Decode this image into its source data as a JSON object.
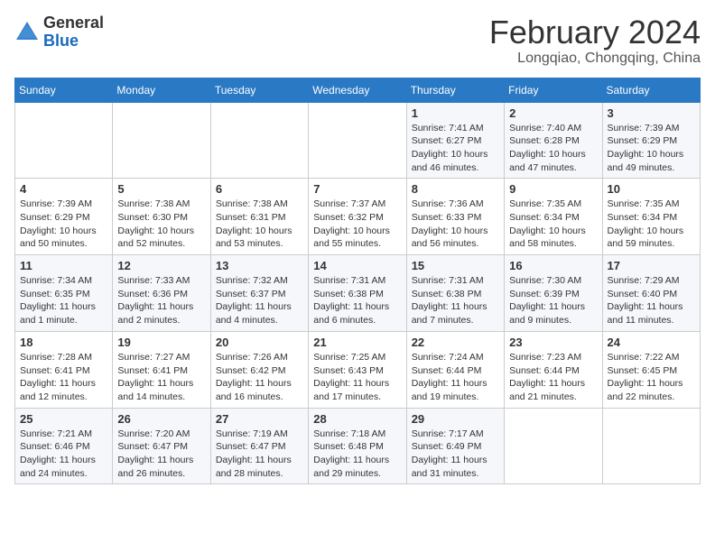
{
  "header": {
    "logo_general": "General",
    "logo_blue": "Blue",
    "month_title": "February 2024",
    "location": "Longqiao, Chongqing, China"
  },
  "days_of_week": [
    "Sunday",
    "Monday",
    "Tuesday",
    "Wednesday",
    "Thursday",
    "Friday",
    "Saturday"
  ],
  "weeks": [
    [
      {
        "day": "",
        "info": ""
      },
      {
        "day": "",
        "info": ""
      },
      {
        "day": "",
        "info": ""
      },
      {
        "day": "",
        "info": ""
      },
      {
        "day": "1",
        "info": "Sunrise: 7:41 AM\nSunset: 6:27 PM\nDaylight: 10 hours\nand 46 minutes."
      },
      {
        "day": "2",
        "info": "Sunrise: 7:40 AM\nSunset: 6:28 PM\nDaylight: 10 hours\nand 47 minutes."
      },
      {
        "day": "3",
        "info": "Sunrise: 7:39 AM\nSunset: 6:29 PM\nDaylight: 10 hours\nand 49 minutes."
      }
    ],
    [
      {
        "day": "4",
        "info": "Sunrise: 7:39 AM\nSunset: 6:29 PM\nDaylight: 10 hours\nand 50 minutes."
      },
      {
        "day": "5",
        "info": "Sunrise: 7:38 AM\nSunset: 6:30 PM\nDaylight: 10 hours\nand 52 minutes."
      },
      {
        "day": "6",
        "info": "Sunrise: 7:38 AM\nSunset: 6:31 PM\nDaylight: 10 hours\nand 53 minutes."
      },
      {
        "day": "7",
        "info": "Sunrise: 7:37 AM\nSunset: 6:32 PM\nDaylight: 10 hours\nand 55 minutes."
      },
      {
        "day": "8",
        "info": "Sunrise: 7:36 AM\nSunset: 6:33 PM\nDaylight: 10 hours\nand 56 minutes."
      },
      {
        "day": "9",
        "info": "Sunrise: 7:35 AM\nSunset: 6:34 PM\nDaylight: 10 hours\nand 58 minutes."
      },
      {
        "day": "10",
        "info": "Sunrise: 7:35 AM\nSunset: 6:34 PM\nDaylight: 10 hours\nand 59 minutes."
      }
    ],
    [
      {
        "day": "11",
        "info": "Sunrise: 7:34 AM\nSunset: 6:35 PM\nDaylight: 11 hours\nand 1 minute."
      },
      {
        "day": "12",
        "info": "Sunrise: 7:33 AM\nSunset: 6:36 PM\nDaylight: 11 hours\nand 2 minutes."
      },
      {
        "day": "13",
        "info": "Sunrise: 7:32 AM\nSunset: 6:37 PM\nDaylight: 11 hours\nand 4 minutes."
      },
      {
        "day": "14",
        "info": "Sunrise: 7:31 AM\nSunset: 6:38 PM\nDaylight: 11 hours\nand 6 minutes."
      },
      {
        "day": "15",
        "info": "Sunrise: 7:31 AM\nSunset: 6:38 PM\nDaylight: 11 hours\nand 7 minutes."
      },
      {
        "day": "16",
        "info": "Sunrise: 7:30 AM\nSunset: 6:39 PM\nDaylight: 11 hours\nand 9 minutes."
      },
      {
        "day": "17",
        "info": "Sunrise: 7:29 AM\nSunset: 6:40 PM\nDaylight: 11 hours\nand 11 minutes."
      }
    ],
    [
      {
        "day": "18",
        "info": "Sunrise: 7:28 AM\nSunset: 6:41 PM\nDaylight: 11 hours\nand 12 minutes."
      },
      {
        "day": "19",
        "info": "Sunrise: 7:27 AM\nSunset: 6:41 PM\nDaylight: 11 hours\nand 14 minutes."
      },
      {
        "day": "20",
        "info": "Sunrise: 7:26 AM\nSunset: 6:42 PM\nDaylight: 11 hours\nand 16 minutes."
      },
      {
        "day": "21",
        "info": "Sunrise: 7:25 AM\nSunset: 6:43 PM\nDaylight: 11 hours\nand 17 minutes."
      },
      {
        "day": "22",
        "info": "Sunrise: 7:24 AM\nSunset: 6:44 PM\nDaylight: 11 hours\nand 19 minutes."
      },
      {
        "day": "23",
        "info": "Sunrise: 7:23 AM\nSunset: 6:44 PM\nDaylight: 11 hours\nand 21 minutes."
      },
      {
        "day": "24",
        "info": "Sunrise: 7:22 AM\nSunset: 6:45 PM\nDaylight: 11 hours\nand 22 minutes."
      }
    ],
    [
      {
        "day": "25",
        "info": "Sunrise: 7:21 AM\nSunset: 6:46 PM\nDaylight: 11 hours\nand 24 minutes."
      },
      {
        "day": "26",
        "info": "Sunrise: 7:20 AM\nSunset: 6:47 PM\nDaylight: 11 hours\nand 26 minutes."
      },
      {
        "day": "27",
        "info": "Sunrise: 7:19 AM\nSunset: 6:47 PM\nDaylight: 11 hours\nand 28 minutes."
      },
      {
        "day": "28",
        "info": "Sunrise: 7:18 AM\nSunset: 6:48 PM\nDaylight: 11 hours\nand 29 minutes."
      },
      {
        "day": "29",
        "info": "Sunrise: 7:17 AM\nSunset: 6:49 PM\nDaylight: 11 hours\nand 31 minutes."
      },
      {
        "day": "",
        "info": ""
      },
      {
        "day": "",
        "info": ""
      }
    ]
  ]
}
